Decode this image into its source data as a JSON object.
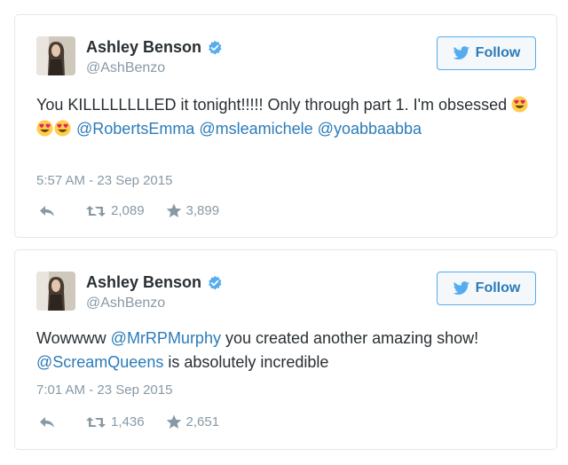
{
  "colors": {
    "link": "#2b7bb9",
    "muted": "#8899a6",
    "text": "#292f33",
    "border": "#e1e8ed",
    "follow_border": "#55acee",
    "verified": "#55acee"
  },
  "tweets": [
    {
      "display_name": "Ashley Benson",
      "screen_name": "@AshBenzo",
      "follow_label": "Follow",
      "text_before": "You KILLLLLLLLED it tonight!!!!! Only through part 1. I'm obsessed ",
      "emoji": [
        "heart-eyes-emoji",
        "heart-eyes-emoji",
        "heart-eyes-emoji"
      ],
      "mentions": [
        "@RobertsEmma",
        "@msleamichele",
        "@yoabbaabba"
      ],
      "timestamp": "5:57 AM - 23 Sep 2015",
      "retweets": "2,089",
      "favorites": "3,899"
    },
    {
      "display_name": "Ashley Benson",
      "screen_name": "@AshBenzo",
      "follow_label": "Follow",
      "text_part1": "Wowwww ",
      "mention_1": "@MrRPMurphy",
      "text_part2": " you created another amazing show! ",
      "mention_2": "@ScreamQueens",
      "text_part3": " is absolutely incredible",
      "timestamp": "7:01 AM - 23 Sep 2015",
      "retweets": "1,436",
      "favorites": "2,651"
    }
  ]
}
